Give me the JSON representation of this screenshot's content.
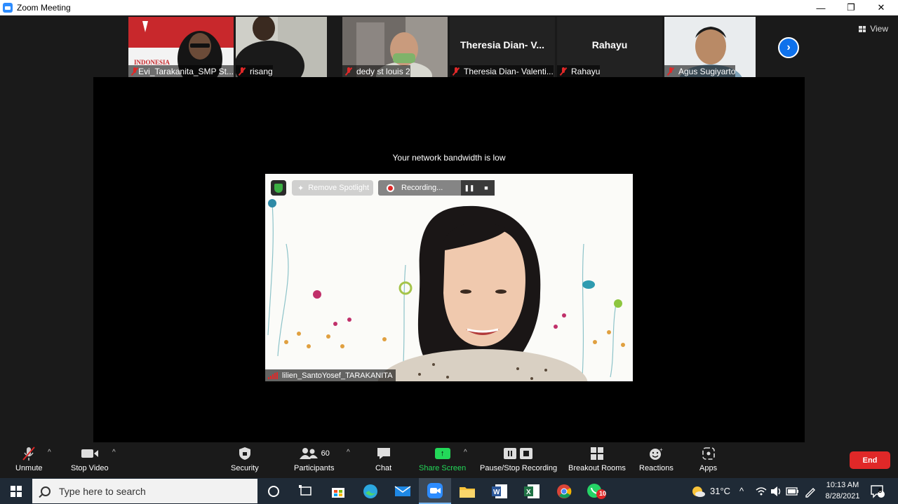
{
  "window": {
    "title": "Zoom Meeting",
    "minimize_glyph": "—",
    "restore_glyph": "❐",
    "close_glyph": "✕"
  },
  "header": {
    "view_label": "View"
  },
  "participants_strip": [
    {
      "name": "Evi_Tarakanita_SMP St...",
      "muted": true
    },
    {
      "name": "risang",
      "muted": true
    },
    {
      "name": "dedy st louis 2",
      "muted": true
    },
    {
      "name": "Theresia Dian- Valenti...",
      "display_name": "Theresia Dian- V...",
      "muted": true
    },
    {
      "name": "Rahayu",
      "display_name": "Rahayu",
      "muted": true
    },
    {
      "name": "Agus Sugiyarto",
      "muted": true
    }
  ],
  "stage": {
    "notice": "Your network bandwidth is low",
    "remove_spotlight_label": "Remove Spotlight",
    "recording_label": "Recording...",
    "speaker_name": "lilien_SantoYosef_TARAKANITA"
  },
  "toolbar": {
    "unmute": "Unmute",
    "stop_video": "Stop Video",
    "security": "Security",
    "participants": "Participants",
    "participants_count": "60",
    "chat": "Chat",
    "share_screen": "Share Screen",
    "pause_stop_recording": "Pause/Stop Recording",
    "breakout_rooms": "Breakout Rooms",
    "reactions": "Reactions",
    "apps": "Apps",
    "end": "End"
  },
  "taskbar": {
    "search_placeholder": "Type here to search",
    "weather": "31°C",
    "time": "10:13 AM",
    "date": "8/28/2021",
    "whatsapp_badge": "10",
    "notification_count": "8",
    "pinned_apps": [
      "cortana-icon",
      "task-view-icon",
      "store-icon",
      "edge-icon",
      "mail-icon",
      "zoom-icon",
      "file-explorer-icon",
      "word-icon",
      "excel-icon",
      "chrome-icon",
      "whatsapp-icon"
    ]
  },
  "colors": {
    "zoom_blue": "#0e71eb",
    "share_green": "#23d959",
    "end_red": "#e02828",
    "muted_red": "#e02828"
  }
}
